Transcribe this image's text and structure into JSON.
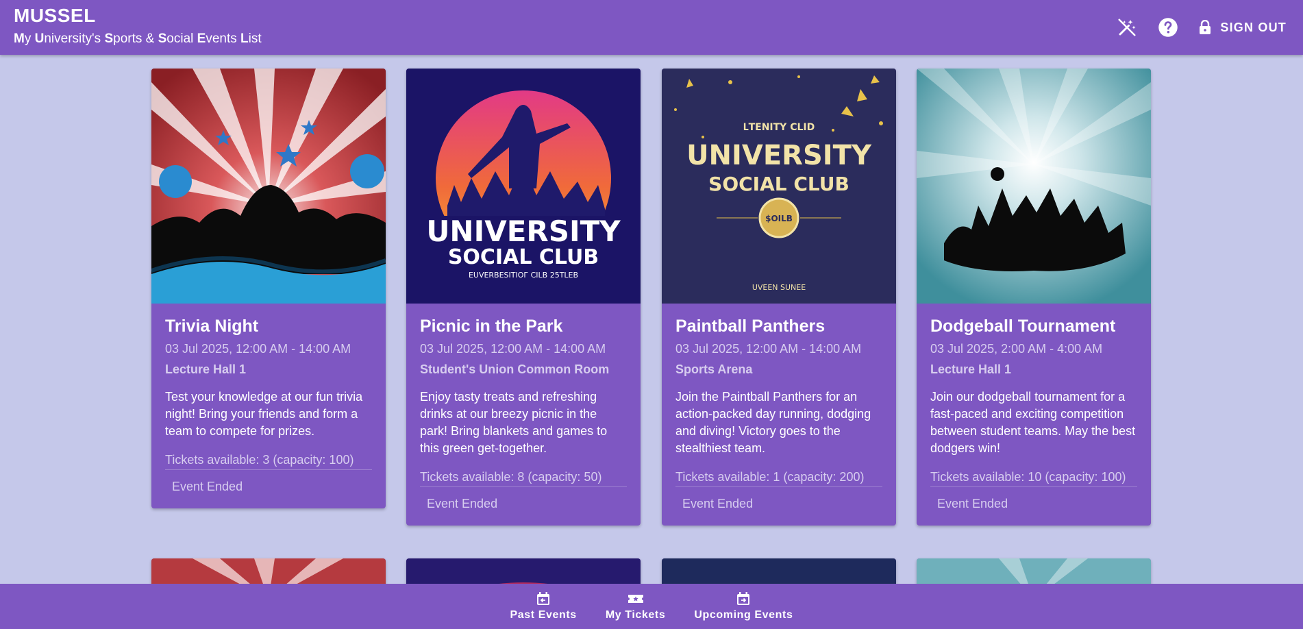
{
  "app": {
    "title": "MUSSEL",
    "subtitle_parts": [
      {
        "b": "M",
        "t": "y "
      },
      {
        "b": "U",
        "t": "niversity's "
      },
      {
        "b": "S",
        "t": "ports & "
      },
      {
        "b": "S",
        "t": "ocial "
      },
      {
        "b": "E",
        "t": "vents "
      },
      {
        "b": "L",
        "t": "ist"
      }
    ]
  },
  "header": {
    "theme_icon": "magic-wand-off-icon",
    "help_icon": "help-circle-icon",
    "signout_icon": "lock-icon",
    "signout_label": "SIGN OUT"
  },
  "events": [
    {
      "title": "Trivia Night",
      "date": "03 Jul 2025, 12:00 AM - 14:00 AM",
      "venue": "Lecture Hall 1",
      "description": "Test your knowledge at our fun trivia night! Bring your friends and form a team to compete for prizes.",
      "tickets": "Tickets available: 3 (capacity: 100)",
      "action": "Event Ended"
    },
    {
      "title": "Picnic in the Park",
      "date": "03 Jul 2025, 12:00 AM - 14:00 AM",
      "venue": "Student's Union Common Room",
      "description": "Enjoy tasty treats and refreshing drinks at our breezy picnic in the park! Bring blankets and games to this green get-together.",
      "tickets": "Tickets available: 8 (capacity: 50)",
      "action": "Event Ended",
      "poster_text": {
        "line1": "UNIVERSITY",
        "line2": "SOCIAL CLUB",
        "line3": "EUVERBESITIOГ CILB 25TLEB"
      }
    },
    {
      "title": "Paintball Panthers",
      "date": "03 Jul 2025, 12:00 AM - 14:00 AM",
      "venue": "Sports Arena",
      "description": "Join the Paintball Panthers for an action-packed day running, dodging and diving! Victory goes to the stealthiest team.",
      "tickets": "Tickets available: 1 (capacity: 200)",
      "action": "Event Ended",
      "poster_text": {
        "top": "ԼTENITY CLID",
        "line1": "UNIVERSITY",
        "line2": "SOCIAL CLUB",
        "badge": "$OILB",
        "bottom": "UVEEN SUNEE"
      }
    },
    {
      "title": "Dodgeball Tournament",
      "date": "03 Jul 2025, 2:00 AM - 4:00 AM",
      "venue": "Lecture Hall 1",
      "description": "Join our dodgeball tournament for a fast-paced and exciting competition between student teams. May the best dodgers win!",
      "tickets": "Tickets available: 10 (capacity: 100)",
      "action": "Event Ended"
    }
  ],
  "bottom_nav": [
    {
      "label": "Past Events",
      "icon": "calendar-arrow-left-icon"
    },
    {
      "label": "My Tickets",
      "icon": "ticket-icon"
    },
    {
      "label": "Upcoming Events",
      "icon": "calendar-arrow-right-icon"
    }
  ]
}
